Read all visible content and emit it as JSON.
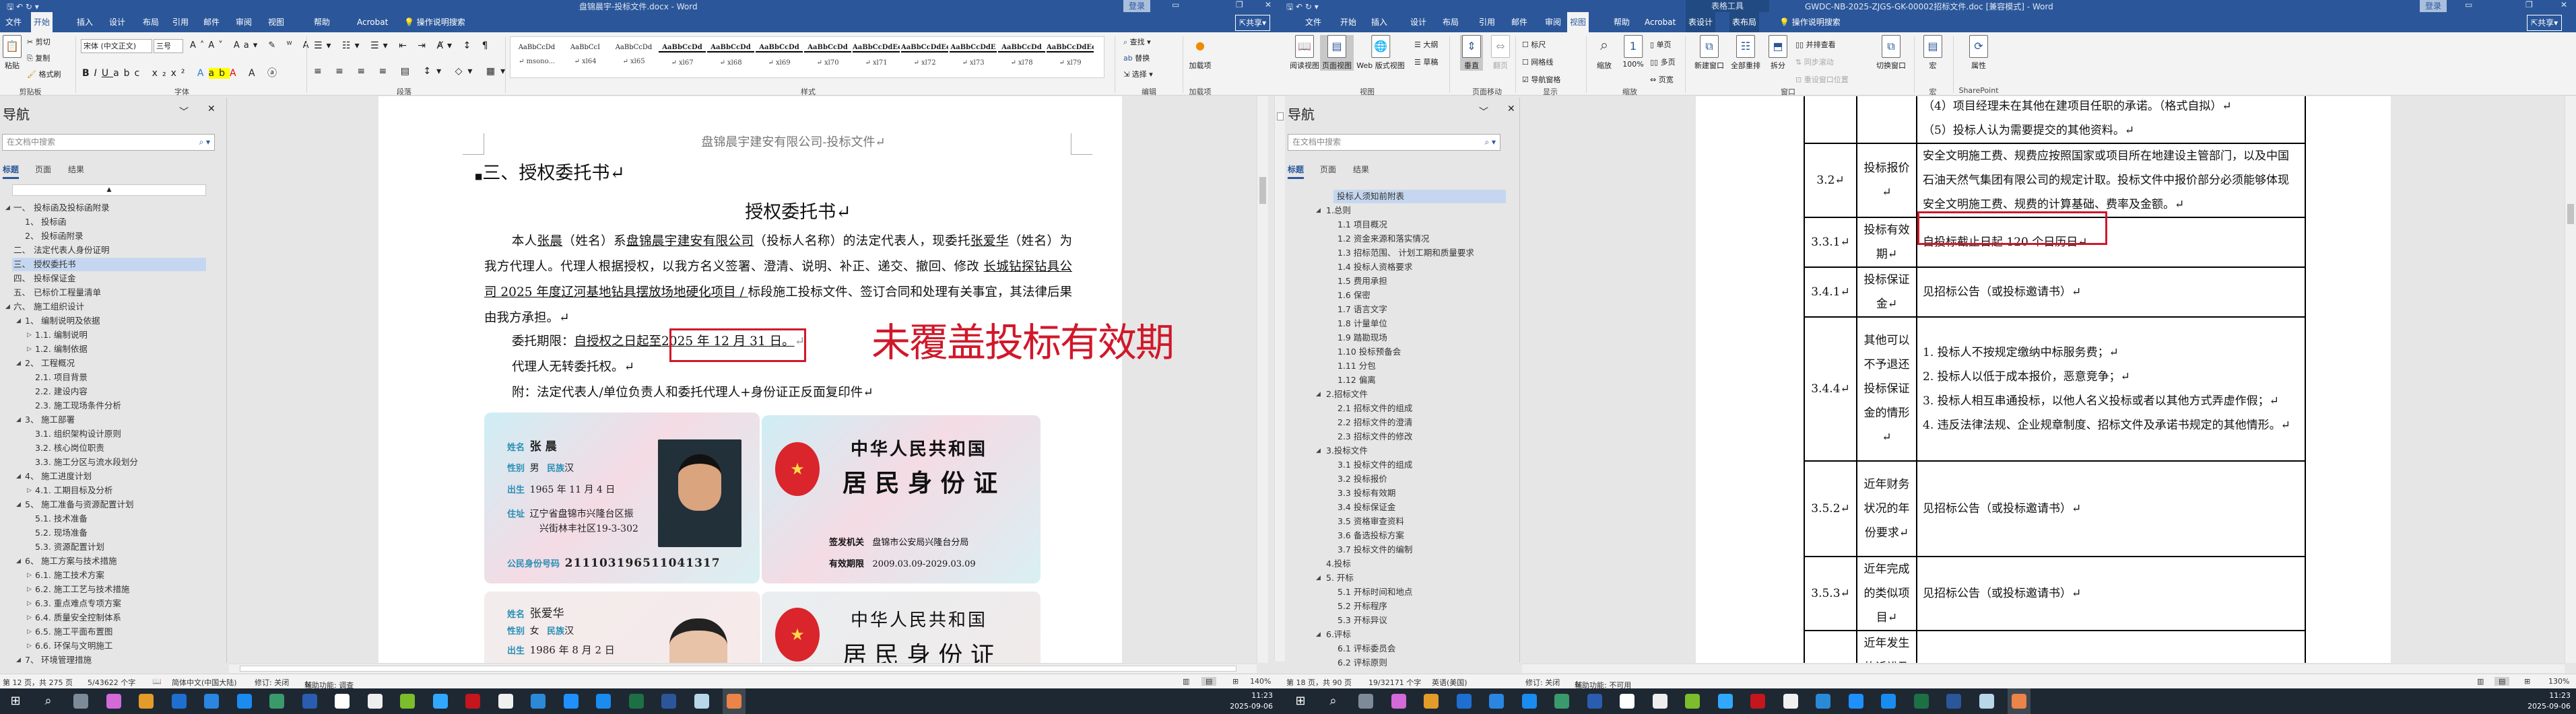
{
  "left_window": {
    "title": "盘锦晨宇-投标文件.docx  -  Word",
    "login": "登录",
    "tabs": [
      "文件",
      "开始",
      "插入",
      "设计",
      "布局",
      "引用",
      "邮件",
      "审阅",
      "视图",
      "帮助",
      "Acrobat",
      "操作说明搜索"
    ],
    "share": "共享",
    "ribbon": {
      "paste": "粘贴",
      "cut": "剪切",
      "copy": "复制",
      "format_painter": "格式刷",
      "font_name": "宋体 (中文正文)",
      "font_size": "三号",
      "styles": [
        {
          "preview": "AaBbCcDd",
          "name": "↵ msono..."
        },
        {
          "preview": "AaBbCcI",
          "name": "↵ xl64"
        },
        {
          "preview": "AaBbCcDd",
          "name": "↵ xl65"
        },
        {
          "preview": "AaBbCcDd",
          "name": "↵ xl67"
        },
        {
          "preview": "AaBbCcDd",
          "name": "↵ xl68"
        },
        {
          "preview": "AaBbCcDd",
          "name": "↵ xl69"
        },
        {
          "preview": "AaBbCcDd",
          "name": "↵ xl70"
        },
        {
          "preview": "AaBbCcDdEe",
          "name": "↵ xl71"
        },
        {
          "preview": "AaBbCcDdEe",
          "name": "↵ xl72"
        },
        {
          "preview": "AaBbCcDdE",
          "name": "↵ xl73"
        },
        {
          "preview": "AaBbCcDd",
          "name": "↵ xl78"
        },
        {
          "preview": "AaBbCcDdEe",
          "name": "↵ xl79"
        }
      ],
      "find": "查找",
      "replace": "替换",
      "select": "选择",
      "addins_btn": "加载项",
      "groups": {
        "clipboard": "剪贴板",
        "font": "字体",
        "paragraph": "段落",
        "styles": "样式",
        "editing": "编辑",
        "addins": "加载项"
      }
    },
    "nav": {
      "title": "导航",
      "search_placeholder": "在文档中搜索",
      "tabs": [
        "标题",
        "页面",
        "结果"
      ],
      "items": [
        {
          "num": "一、",
          "text": "投标函及投标函附录",
          "level": 1,
          "exp": "open"
        },
        {
          "num": "1、",
          "text": "投标函",
          "level": 2,
          "exp": ""
        },
        {
          "num": "2、",
          "text": "投标函附录",
          "level": 2,
          "exp": ""
        },
        {
          "num": "二、",
          "text": "法定代表人身份证明",
          "level": 1,
          "exp": ""
        },
        {
          "num": "三、",
          "text": "授权委托书",
          "level": 1,
          "exp": "",
          "selected": true
        },
        {
          "num": "四、",
          "text": "投标保证金",
          "level": 1,
          "exp": ""
        },
        {
          "num": "五、",
          "text": "已标价工程量清单",
          "level": 1,
          "exp": ""
        },
        {
          "num": "六、",
          "text": "施工组织设计",
          "level": 1,
          "exp": "open"
        },
        {
          "num": "1、",
          "text": "编制说明及依据",
          "level": 2,
          "exp": "open"
        },
        {
          "num": "",
          "text": "1.1. 编制说明",
          "level": 3,
          "exp": "closed"
        },
        {
          "num": "",
          "text": "1.2. 编制依据",
          "level": 3,
          "exp": "closed"
        },
        {
          "num": "2、",
          "text": "工程概况",
          "level": 2,
          "exp": "open"
        },
        {
          "num": "",
          "text": "2.1. 项目背景",
          "level": 3,
          "exp": ""
        },
        {
          "num": "",
          "text": "2.2. 建设内容",
          "level": 3,
          "exp": ""
        },
        {
          "num": "",
          "text": "2.3. 施工现场条件分析",
          "level": 3,
          "exp": ""
        },
        {
          "num": "3、",
          "text": "施工部署",
          "level": 2,
          "exp": "open"
        },
        {
          "num": "",
          "text": "3.1. 组织架构设计原则",
          "level": 3,
          "exp": ""
        },
        {
          "num": "",
          "text": "3.2. 核心岗位职责",
          "level": 3,
          "exp": ""
        },
        {
          "num": "",
          "text": "3.3. 施工分区与流水段划分",
          "level": 3,
          "exp": ""
        },
        {
          "num": "4、",
          "text": "施工进度计划",
          "level": 2,
          "exp": "open"
        },
        {
          "num": "",
          "text": "4.1. 工期目标及分析",
          "level": 3,
          "exp": "closed"
        },
        {
          "num": "5、",
          "text": "施工准备与资源配置计划",
          "level": 2,
          "exp": "open"
        },
        {
          "num": "",
          "text": "5.1. 技术准备",
          "level": 3,
          "exp": ""
        },
        {
          "num": "",
          "text": "5.2. 现场准备",
          "level": 3,
          "exp": ""
        },
        {
          "num": "",
          "text": "5.3. 资源配置计划",
          "level": 3,
          "exp": ""
        },
        {
          "num": "6、",
          "text": "施工方案与技术措施",
          "level": 2,
          "exp": "open"
        },
        {
          "num": "",
          "text": "6.1. 施工技术方案",
          "level": 3,
          "exp": "closed"
        },
        {
          "num": "",
          "text": "6.2. 施工工艺与技术措施",
          "level": 3,
          "exp": "closed"
        },
        {
          "num": "",
          "text": "6.3. 重点难点专项方案",
          "level": 3,
          "exp": "closed"
        },
        {
          "num": "",
          "text": "6.4. 质量安全控制体系",
          "level": 3,
          "exp": "closed"
        },
        {
          "num": "",
          "text": "6.5. 施工平面布置图",
          "level": 3,
          "exp": "closed"
        },
        {
          "num": "",
          "text": "6.6. 环保与文明施工",
          "level": 3,
          "exp": "closed"
        },
        {
          "num": "7、",
          "text": "环境管理措施",
          "level": 2,
          "exp": "open"
        }
      ]
    },
    "document": {
      "header": "盘锦晨宇建安有限公司-投标文件↵",
      "heading": "三、授权委托书↵",
      "title": "授权委托书↵",
      "p1": [
        {
          "t": "本人",
          "u": false
        },
        {
          "t": "张晨",
          "u": true
        },
        {
          "t": "（姓名）系",
          "u": false
        },
        {
          "t": "盘锦晨宇建安有限公司",
          "u": true
        },
        {
          "t": "（投标人名称）的法定代表人，现委托",
          "u": false
        },
        {
          "t": "张爱华",
          "u": true
        },
        {
          "t": "（姓名）为我方代理人。代理人根据授权，以我方名义签署、澄清、说明、补正、递交、撤回、修改 ",
          "u": false
        },
        {
          "t": "长城钻探钻具公司 2025 年度辽河基地钻具摆放场地硬化项目 / ",
          "u": true
        },
        {
          "t": "标段施工投标文件、签订合同和处理有关事宜，其法律后果由我方承担。↵",
          "u": false
        }
      ],
      "term_label": "委托期限：",
      "term_value_a": "自授权之日起至",
      "term_value_b": "2025 年 12 月 31 日。",
      "no_transfer": "代理人无转委托权。↵",
      "attachment": "附：法定代表人/单位负责人和委托代理人+身份证正反面复印件↵",
      "id_cards": {
        "card1": {
          "name_k": "姓名",
          "name": "张 晨",
          "sex_k": "性别",
          "sex": "男",
          "eth_k": "民族",
          "eth": "汉",
          "birth_k": "出生",
          "birth": "1965 年 11 月 4 日",
          "addr_k": "住址",
          "addr1": "辽宁省盘锦市兴隆台区振",
          "addr2": "兴街林丰社区19-3-302",
          "id_k": "公民身份号码",
          "id": "211103196511041317"
        },
        "card2": {
          "country": "中华人民共和国",
          "doc": "居 民 身 份 证",
          "issuer_k": "签发机关",
          "issuer": "盘锦市公安局兴隆台分局",
          "valid_k": "有效期限",
          "valid": "2009.03.09-2029.03.09"
        },
        "card3": {
          "name_k": "姓名",
          "name": "张爱华",
          "sex_k": "性别",
          "sex": "女",
          "eth_k": "民族",
          "eth": "汉",
          "birth_k": "出生",
          "birth": "1986 年 8 月 2 日"
        },
        "card4": {
          "country": "中华人民共和国",
          "doc": "居 民 身 份 证"
        }
      }
    },
    "status": {
      "page": "第 12 页，共 275 页",
      "words": "5/43622 个字",
      "lang": "简体中文(中国大陆)",
      "track": "修订: 关闭",
      "access": "辅助功能: 调查",
      "zoom": "140%"
    }
  },
  "right_window": {
    "title": "GWDC-NB-2025-ZJGS-GK-00002招标文件.doc [兼容模式]  -  Word",
    "context_tab": "表格工具",
    "login": "登录",
    "tabs": [
      "文件",
      "开始",
      "插入",
      "设计",
      "布局",
      "引用",
      "邮件",
      "审阅",
      "视图",
      "帮助",
      "Acrobat",
      "表设计",
      "表布局",
      "操作说明搜索"
    ],
    "share": "共享",
    "ribbon": {
      "read_view": "阅读视图",
      "print_layout": "页面视图",
      "web_layout": "Web 版式视图",
      "outline": "大纲",
      "draft": "草稿",
      "vertical": "垂直",
      "side_to_side": "翻页",
      "ruler": "标尺",
      "gridlines": "网格线",
      "nav_pane": "导航窗格",
      "zoom": "缩放",
      "zoom100": "100%",
      "one_page": "单页",
      "multi_page": "多页",
      "page_width": "页宽",
      "new_window": "新建窗口",
      "arrange_all": "全部重排",
      "split": "拆分",
      "side_by_side": "并排查看",
      "sync_scroll": "同步滚动",
      "reset_pos": "重设窗口位置",
      "switch_windows": "切换窗口",
      "macros": "宏",
      "properties": "属性",
      "groups": {
        "views": "视图",
        "page_movement": "页面移动",
        "show": "显示",
        "zoom": "缩放",
        "window": "窗口",
        "macros": "宏",
        "sharepoint": "SharePoint"
      }
    },
    "nav": {
      "title": "导航",
      "search_placeholder": "在文档中搜索",
      "tabs": [
        "标题",
        "页面",
        "结果"
      ],
      "items": [
        {
          "text": "投标人须知前附表",
          "level": 0,
          "exp": "",
          "selected": true
        },
        {
          "text": "1.总则",
          "level": 1,
          "exp": "open"
        },
        {
          "text": "1.1 项目概况",
          "level": 2,
          "exp": ""
        },
        {
          "text": "1.2 资金来源和落实情况",
          "level": 2,
          "exp": ""
        },
        {
          "text": "1.3 招标范围、 计划工期和质量要求",
          "level": 2,
          "exp": ""
        },
        {
          "text": "1.4 投标人资格要求",
          "level": 2,
          "exp": ""
        },
        {
          "text": "1.5 费用承担",
          "level": 2,
          "exp": ""
        },
        {
          "text": "1.6 保密",
          "level": 2,
          "exp": ""
        },
        {
          "text": "1.7 语言文字",
          "level": 2,
          "exp": ""
        },
        {
          "text": "1.8 计量单位",
          "level": 2,
          "exp": ""
        },
        {
          "text": "1.9 踏勘现场",
          "level": 2,
          "exp": ""
        },
        {
          "text": "1.10 投标预备会",
          "level": 2,
          "exp": ""
        },
        {
          "text": "1.11 分包",
          "level": 2,
          "exp": ""
        },
        {
          "text": "1.12 偏离",
          "level": 2,
          "exp": ""
        },
        {
          "text": "2.招标文件",
          "level": 1,
          "exp": "open"
        },
        {
          "text": "2.1 招标文件的组成",
          "level": 2,
          "exp": ""
        },
        {
          "text": "2.2 招标文件的澄清",
          "level": 2,
          "exp": ""
        },
        {
          "text": "2.3 招标文件的修改",
          "level": 2,
          "exp": ""
        },
        {
          "text": "3.投标文件",
          "level": 1,
          "exp": "open"
        },
        {
          "text": "3.1 投标文件的组成",
          "level": 2,
          "exp": ""
        },
        {
          "text": "3.2 投标报价",
          "level": 2,
          "exp": ""
        },
        {
          "text": "3.3 投标有效期",
          "level": 2,
          "exp": ""
        },
        {
          "text": "3.4 投标保证金",
          "level": 2,
          "exp": ""
        },
        {
          "text": "3.5 资格审查资料",
          "level": 2,
          "exp": ""
        },
        {
          "text": "3.6 备选投标方案",
          "level": 2,
          "exp": ""
        },
        {
          "text": "3.7 投标文件的编制",
          "level": 2,
          "exp": ""
        },
        {
          "text": "4.投标",
          "level": 1,
          "exp": ""
        },
        {
          "text": "5. 开标",
          "level": 1,
          "exp": "open"
        },
        {
          "text": "5.1 开标时间和地点",
          "level": 2,
          "exp": ""
        },
        {
          "text": "5.2 开标程序",
          "level": 2,
          "exp": ""
        },
        {
          "text": "5.3 开标异议",
          "level": 2,
          "exp": ""
        },
        {
          "text": "6.评标",
          "level": 1,
          "exp": "open"
        },
        {
          "text": "6.1 评标委员会",
          "level": 2,
          "exp": ""
        },
        {
          "text": "6.2 评标原则",
          "level": 2,
          "exp": ""
        }
      ]
    },
    "table": {
      "rows": [
        {
          "num": "",
          "label": "",
          "lines": [
            "（4）项目经理未在其他在建项目任职的承诺。（格式自拟）↵",
            "（5）投标人认为需要提交的其他资料。↵"
          ]
        },
        {
          "num": "3.2↵",
          "label": "投标报价↵",
          "lines": [
            "安全文明施工费、规费应按照国家或项目所在地建设主管部门，以及中国石油天然气集团有限公司的规定计取。投标文件中报价部分必须能够体现安全文明施工费、规费的计算基础、费率及金额。↵"
          ]
        },
        {
          "num": "3.3.1↵",
          "label": "投标有效期↵",
          "lines": [
            "自投标截止日起 120 个日历日↵"
          ],
          "highlight": true
        },
        {
          "num": "3.4.1↵",
          "label": "投标保证金↵",
          "lines": [
            "见招标公告（或投标邀请书）↵"
          ]
        },
        {
          "num": "3.4.4↵",
          "label": "其他可以不予退还投标保证金的情形↵",
          "lines": [
            "1. 投标人不按规定缴纳中标服务费；↵",
            "2. 投标人以低于成本报价，恶意竞争；↵",
            "3. 投标人相互串通投标，以他人名义投标或者以其他方式弄虚作假；↵",
            "4. 违反法律法规、企业规章制度、招标文件及承诺书规定的其他情形。↵"
          ]
        },
        {
          "num": "3.5.2↵",
          "label": "近年财务状况的年份要求↵",
          "lines": [
            "见招标公告（或投标邀请书）↵"
          ]
        },
        {
          "num": "3.5.3↵",
          "label": "近年完成的类似项目↵",
          "lines": [
            "见招标公告（或投标邀请书）↵"
          ]
        },
        {
          "num": "",
          "label": "近年发生的诉讼及仲",
          "lines": [
            ""
          ]
        }
      ]
    },
    "status": {
      "page": "第 18 页，共 90 页",
      "words": "19/32171 个字",
      "lang": "英语(美国)",
      "track": "修订: 关闭",
      "access": "辅助功能: 不可用",
      "zoom": "130%"
    }
  },
  "annotation": {
    "text": "未覆盖投标有效期",
    "color": "#d0182a"
  },
  "taskbar": {
    "time": "11:23",
    "date": "2025-09-06",
    "icons": [
      "windows-start",
      "search",
      "calculator",
      "color-app",
      "orange-app",
      "blue-dots",
      "blue-app",
      "blue-circle-app",
      "dark-app",
      "network-app",
      "file-app",
      "document-app",
      "green-app",
      "photoshop",
      "acrobat",
      "qq",
      "xl-app",
      "chat-app",
      "blue-q-app",
      "excel",
      "word",
      "glass-app",
      "wechat-green"
    ],
    "icon_colors": [
      "#ffffff",
      "#ffffff",
      "#7d8b99",
      "#d46ad8",
      "#e39b2a",
      "#1f6fd1",
      "#2a86e0",
      "#1a8cf0",
      "#3b9a6b",
      "#2a5db0",
      "#ffffff",
      "#eeeeee",
      "#7bbd2b",
      "#31a8ff",
      "#c4161c",
      "#f0f0f0",
      "#2a8ad8",
      "#1e90ff",
      "#1a8cf0",
      "#1d7044",
      "#2b579a",
      "#b8d7e8",
      "#e86f2a"
    ]
  }
}
